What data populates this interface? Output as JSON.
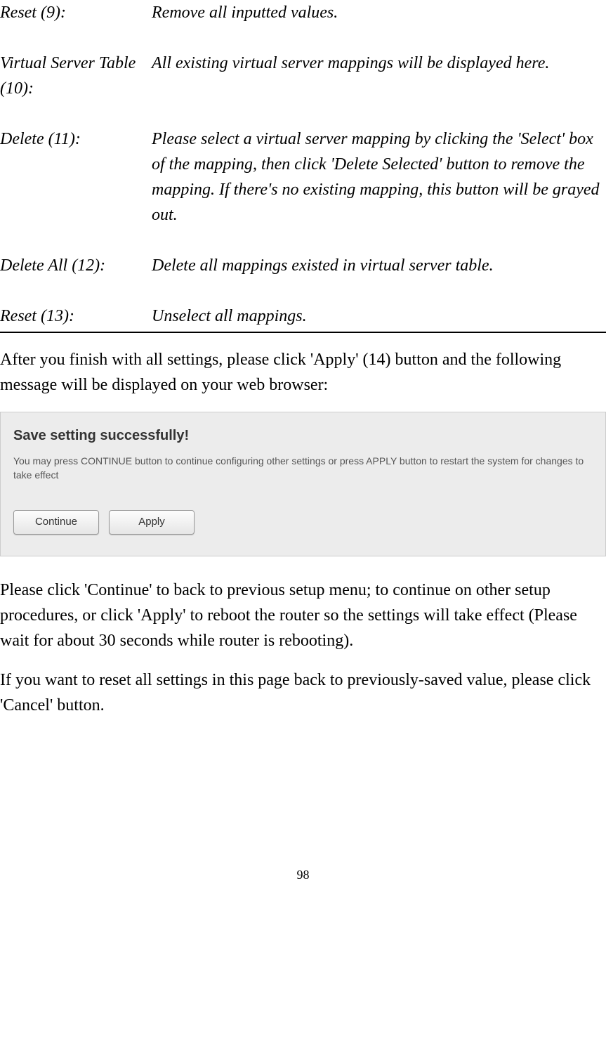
{
  "definitions": [
    {
      "term": "Reset (9):",
      "desc": "Remove all inputted values."
    },
    {
      "term": "Virtual Server Table (10):",
      "desc": "All existing virtual server mappings will be displayed here."
    },
    {
      "term": "Delete (11):",
      "desc": "Please select a virtual server mapping by clicking the 'Select' box of the mapping, then click 'Delete Selected' button to remove the mapping. If there's no existing mapping, this button will be grayed out."
    },
    {
      "term": "Delete All (12):",
      "desc": "Delete all mappings existed in virtual server table."
    },
    {
      "term": "Reset (13):",
      "desc": "Unselect all mappings."
    }
  ],
  "paragraphs": {
    "after_settings": "After you finish with all settings, please click 'Apply' (14) button and the following message will be displayed on your web browser:",
    "continue_info": "Please click 'Continue' to back to previous setup menu; to continue on other setup procedures, or click 'Apply' to reboot the router so the settings will take effect (Please wait for about 30 seconds while router is rebooting).",
    "cancel_info": "If you want to reset all settings in this page back to previously-saved value, please click 'Cancel' button."
  },
  "dialog": {
    "title": "Save setting successfully!",
    "text": "You may press CONTINUE button to continue configuring other settings or press APPLY button to restart the system for changes to take effect",
    "continue_label": "Continue",
    "apply_label": "Apply"
  },
  "page_number": "98"
}
